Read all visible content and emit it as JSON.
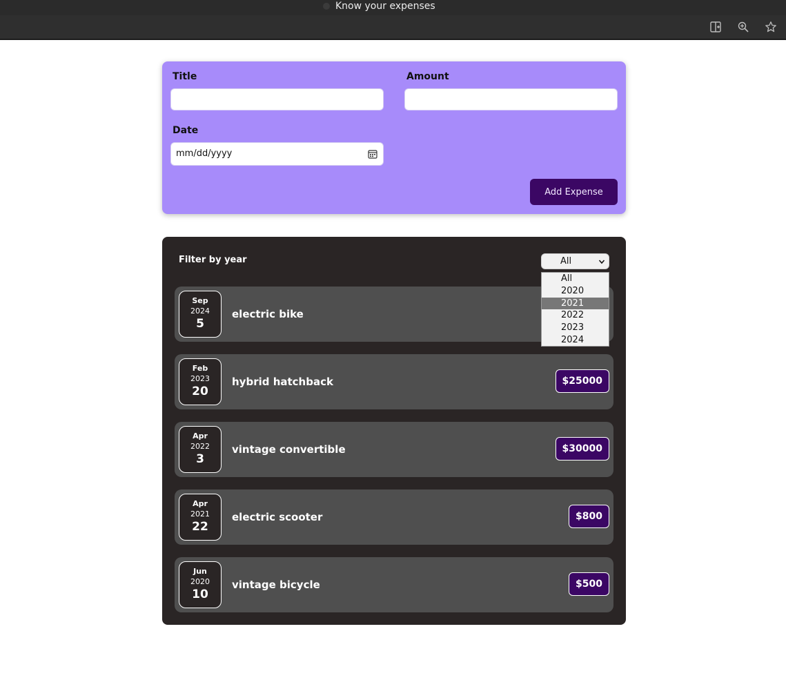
{
  "window": {
    "title": "Know your expenses"
  },
  "toolbar": {
    "icons": [
      "reader-mode-icon",
      "zoom-icon",
      "star-icon"
    ]
  },
  "form": {
    "title_label": "Title",
    "amount_label": "Amount",
    "date_label": "Date",
    "title_value": "",
    "amount_value": "",
    "date_placeholder": "mm/dd/yyyy",
    "add_button_label": "Add Expense"
  },
  "filter": {
    "label": "Filter by year",
    "selected": "All",
    "options": [
      "All",
      "2020",
      "2021",
      "2022",
      "2023",
      "2024"
    ],
    "highlighted": "2021"
  },
  "expenses": [
    {
      "month": "Sep",
      "year": "2024",
      "day": "5",
      "title": "electric bike",
      "amount": ""
    },
    {
      "month": "Feb",
      "year": "2023",
      "day": "20",
      "title": "hybrid hatchback",
      "amount": "$25000"
    },
    {
      "month": "Apr",
      "year": "2022",
      "day": "3",
      "title": "vintage convertible",
      "amount": "$30000"
    },
    {
      "month": "Apr",
      "year": "2021",
      "day": "22",
      "title": "electric scooter",
      "amount": "$800"
    },
    {
      "month": "Jun",
      "year": "2020",
      "day": "10",
      "title": "vintage bicycle",
      "amount": "$500"
    }
  ],
  "colors": {
    "form_bg": "#a78bfa",
    "accent": "#3b0764",
    "list_bg": "#2a2525",
    "item_bg": "#4f4f4f"
  }
}
